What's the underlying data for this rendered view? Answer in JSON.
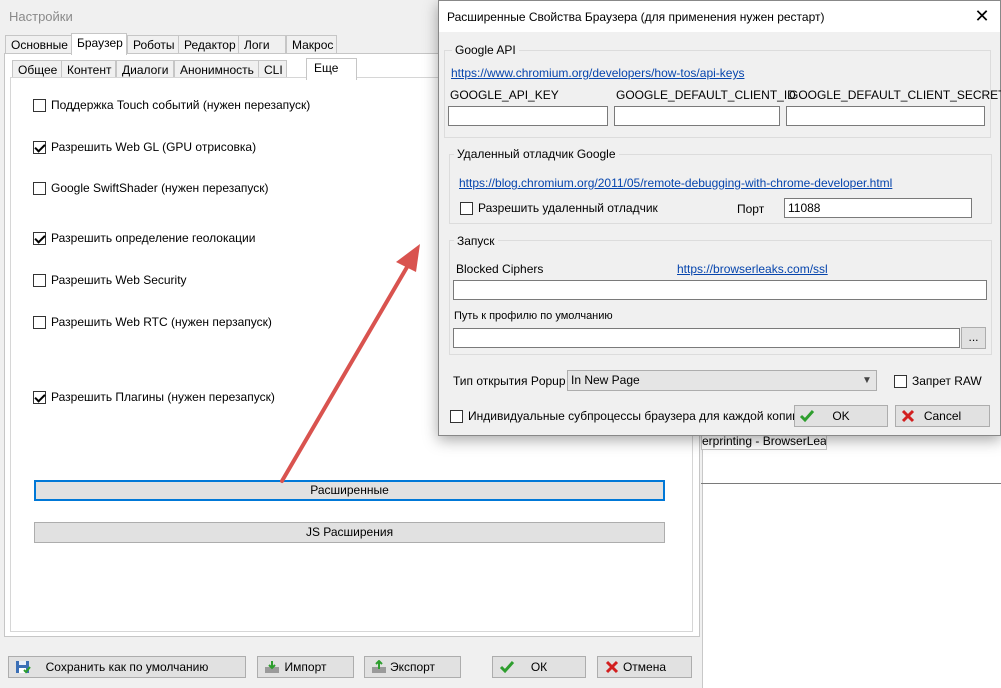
{
  "settings_window": {
    "title": "Настройки",
    "main_tabs": [
      "Основные",
      "Браузер",
      "Роботы",
      "Редактор",
      "Логи",
      "Макрос"
    ],
    "sub_tabs": [
      "Общее",
      "Контент",
      "Диалоги",
      "Анонимность",
      "CLI",
      "Еще"
    ],
    "checkboxes": [
      {
        "label": "Поддержка Touch событий (нужен перезапуск)",
        "checked": false
      },
      {
        "label": "Разрешить Web GL (GPU отрисовка)",
        "checked": true
      },
      {
        "label": "Google SwiftShader (нужен перезапуск)",
        "checked": false
      },
      {
        "label": "Разрешить определение геолокации",
        "checked": true
      },
      {
        "label": "Разрешить Web Security",
        "checked": false
      },
      {
        "label": "Разрешить  Web RTC (нужен перзапуск)",
        "checked": false
      },
      {
        "label": "Разрешить Плагины (нужен перезапуск)",
        "checked": true
      }
    ],
    "advanced_button": "Расширенные",
    "js_extensions_button": "JS Расширения",
    "bottom_buttons": {
      "save_default": "Сохранить как по умолчанию",
      "import": "Импорт",
      "export": "Экспорт",
      "ok": "ОК",
      "cancel": "Отмена"
    },
    "behind_tab_text": "erprinting - BrowserLeaks"
  },
  "advanced_dialog": {
    "title": "Расширенные Свойства Браузера (для применения нужен рестарт)",
    "google_api": {
      "group_label": "Google API",
      "link": "https://www.chromium.org/developers/how-tos/api-keys",
      "labels": [
        "GOOGLE_API_KEY",
        "GOOGLE_DEFAULT_CLIENT_ID",
        "GOOGLE_DEFAULT_CLIENT_SECRET"
      ],
      "values": [
        "",
        "",
        ""
      ]
    },
    "remote_debugger": {
      "group_label": "Удаленный отладчик  Google",
      "link": "https://blog.chromium.org/2011/05/remote-debugging-with-chrome-developer.html",
      "allow_label": "Разрешить удаленный отладчик",
      "allow_checked": false,
      "port_label": "Порт",
      "port_value": "11088"
    },
    "launch": {
      "group_label": "Запуск",
      "blocked_ciphers_label": "Blocked Ciphers",
      "link": "https://browserleaks.com/ssl",
      "blocked_ciphers_value": "",
      "profile_path_label": "Путь к профилю по умолчанию",
      "profile_path_value": "",
      "browse_button": "..."
    },
    "popup_label": "Тип открытия Popup",
    "popup_value": "In New Page",
    "raw_ban_label": "Запрет RAW",
    "raw_ban_checked": false,
    "subprocess_label": "Индивидуальные субпроцессы  браузера для каждой копии",
    "subprocess_checked": false,
    "ok": "OK",
    "cancel": "Cancel"
  },
  "colors": {
    "accent_focus": "#0078d7",
    "link": "#0645ad",
    "annotation_arrow": "#d9534f",
    "ok_check": "#2e9e2e",
    "cancel_x": "#d21f1f"
  }
}
